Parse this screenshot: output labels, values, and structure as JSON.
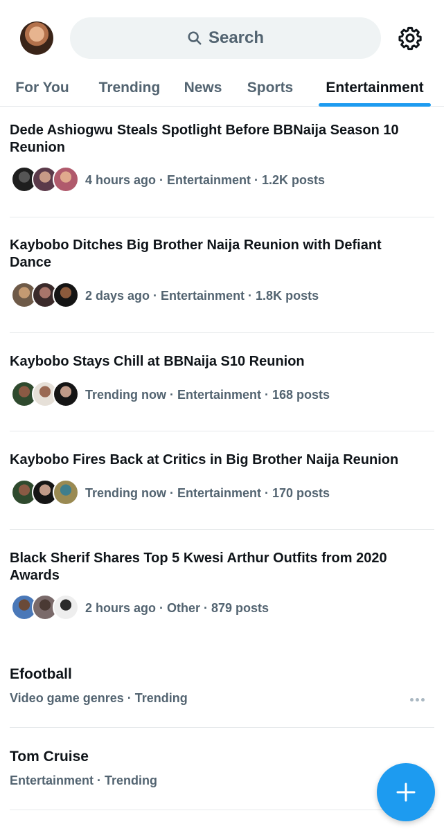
{
  "header": {
    "search_placeholder": "Search"
  },
  "tabs": [
    {
      "label": "For You"
    },
    {
      "label": "Trending"
    },
    {
      "label": "News"
    },
    {
      "label": "Sports"
    },
    {
      "label": "Entertainment"
    }
  ],
  "active_tab": "Entertainment",
  "trends": [
    {
      "title": "Dede Ashiogwu Steals Spotlight Before BBNaija Season 10 Reunion",
      "meta": "4 hours ago · Entertainment · 1.2K posts"
    },
    {
      "title": "Kaybobo Ditches Big Brother Naija Reunion with Defiant Dance",
      "meta": "2 days ago · Entertainment · 1.8K posts"
    },
    {
      "title": "Kaybobo Stays Chill at BBNaija S10 Reunion",
      "meta": "Trending now · Entertainment · 168 posts"
    },
    {
      "title": "Kaybobo Fires Back at Critics in Big Brother Naija Reunion",
      "meta": "Trending now · Entertainment · 170 posts"
    },
    {
      "title": "Black Sherif Shares Top 5 Kwesi Arthur Outfits from 2020 Awards",
      "meta": "2 hours ago · Other · 879 posts"
    }
  ],
  "topics": [
    {
      "title": "Efootball",
      "meta": "Video game genres · Trending"
    },
    {
      "title": "Tom Cruise",
      "meta": "Entertainment · Trending"
    }
  ],
  "colors": {
    "accent": "#1d9bf0",
    "secondary_text": "#536471",
    "primary_text": "#0f1419"
  },
  "icons": [
    "search-icon",
    "gear-icon",
    "more-icon",
    "plus-icon"
  ]
}
